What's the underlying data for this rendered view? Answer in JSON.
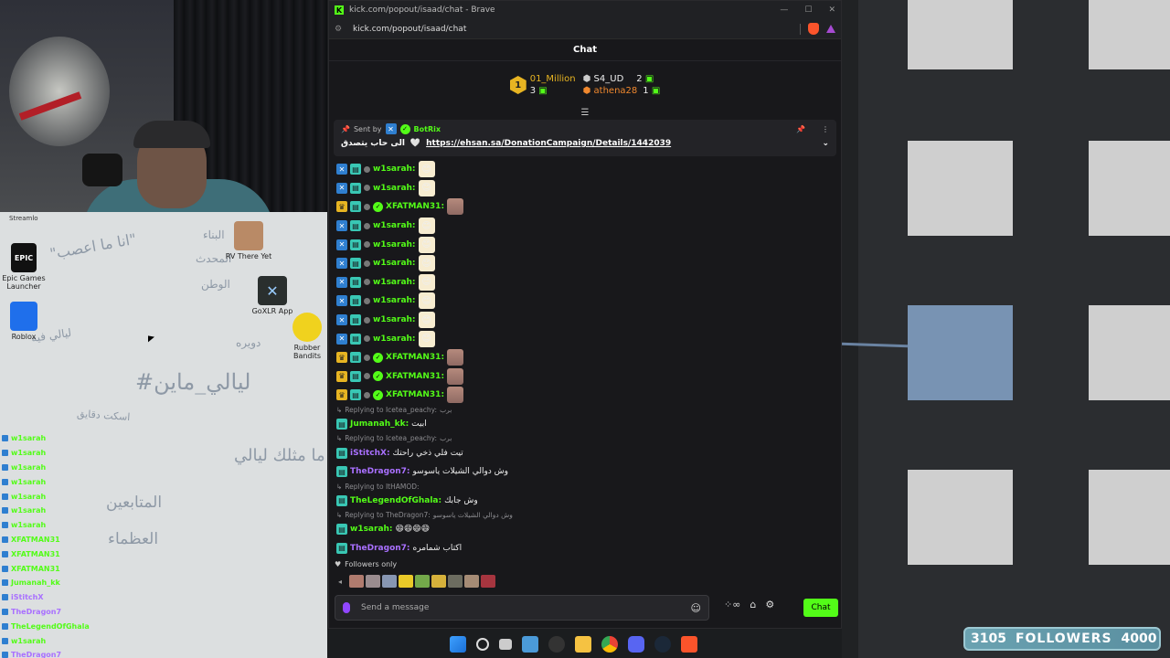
{
  "browser": {
    "title": "kick.com/popout/isaad/chat - Brave",
    "url": "kick.com/popout/isaad/chat"
  },
  "chat": {
    "header": "Chat",
    "leaderboard": {
      "first": {
        "rank": "1",
        "name": "01_Million",
        "count": "3"
      },
      "second": {
        "name": "S4_UD",
        "count": "2"
      },
      "third": {
        "name": "athena28",
        "count": "1"
      }
    },
    "pinned": {
      "sent_by": "Sent by",
      "sender": "BotRix",
      "text": "الى حاب يتصدق",
      "link": "https://ehsan.sa/DonationCampaign/Details/1442039"
    },
    "messages": [
      {
        "user": "w1sarah:",
        "color": "#53fc18",
        "kind": "msg",
        "sticker": "face"
      },
      {
        "user": "w1sarah:",
        "color": "#53fc18",
        "kind": "msg",
        "sticker": "face"
      },
      {
        "user": "XFATMAN31:",
        "color": "#53fc18",
        "kind": "msg",
        "sticker": "photo",
        "crown": true
      },
      {
        "user": "w1sarah:",
        "color": "#53fc18",
        "kind": "msg",
        "sticker": "face"
      },
      {
        "user": "w1sarah:",
        "color": "#53fc18",
        "kind": "msg",
        "sticker": "face"
      },
      {
        "user": "w1sarah:",
        "color": "#53fc18",
        "kind": "msg",
        "sticker": "face"
      },
      {
        "user": "w1sarah:",
        "color": "#53fc18",
        "kind": "msg",
        "sticker": "face"
      },
      {
        "user": "w1sarah:",
        "color": "#53fc18",
        "kind": "msg",
        "sticker": "face"
      },
      {
        "user": "w1sarah:",
        "color": "#53fc18",
        "kind": "msg",
        "sticker": "face"
      },
      {
        "user": "w1sarah:",
        "color": "#53fc18",
        "kind": "msg",
        "sticker": "face"
      },
      {
        "user": "XFATMAN31:",
        "color": "#53fc18",
        "kind": "msg",
        "sticker": "photo",
        "crown": true
      },
      {
        "user": "XFATMAN31:",
        "color": "#53fc18",
        "kind": "msg",
        "sticker": "photo",
        "crown": true
      },
      {
        "user": "XFATMAN31:",
        "color": "#53fc18",
        "kind": "msg",
        "sticker": "photo",
        "crown": true
      }
    ],
    "replies": [
      {
        "reply_to": "Replying to Icetea_peachy:",
        "reply_text": "برب",
        "user": "Jumanah_kk:",
        "color": "#53fc18",
        "text": "ابيت"
      },
      {
        "reply_to": "Replying to Icetea_peachy:",
        "reply_text": "برب",
        "user": "iStitchX:",
        "color": "#a970ff",
        "text": "تيت فلي ذخي راحتك"
      },
      {
        "reply_to": "",
        "reply_text": "",
        "user": "TheDragon7:",
        "color": "#a970ff",
        "text": "وش دوالي الشيلات ياسوسو"
      },
      {
        "reply_to": "Replying to ItHAMOD:",
        "reply_text": "",
        "user": "TheLegendOfGhala:",
        "color": "#53fc18",
        "text": "وش جابك"
      },
      {
        "reply_to": "Replying to TheDragon7:",
        "reply_text": "وش دوالي الشيلات ياسوسو",
        "user": "w1sarah:",
        "color": "#53fc18",
        "text": "😄😄😄😄"
      },
      {
        "reply_to": "",
        "reply_text": "",
        "user": "TheDragon7:",
        "color": "#a970ff",
        "text": "اكتاب شمامره"
      }
    ],
    "followers_only": "Followers only",
    "composer_placeholder": "Send a message",
    "send_label": "Chat",
    "infinity": "∞"
  },
  "desktop": {
    "icons": [
      {
        "label": "Epic Games Launcher"
      },
      {
        "label": "Roblox"
      },
      {
        "label": "RV There Yet"
      },
      {
        "label": "GoXLR App"
      },
      {
        "label": "Rubber Bandits"
      }
    ],
    "streamlabs_label": "Streamlo",
    "words": [
      "\"انا ما اعصب\"",
      "البناء",
      "المحدث",
      "الوطن",
      "ليالي فيه",
      "دويره",
      "#ليالي_ماين",
      "اسكت دقايق",
      "ما مثلك ليالي",
      "المتابعين",
      "العظماء"
    ]
  },
  "overlay_chat": [
    {
      "user": "w1sarah",
      "color": "#53fc18"
    },
    {
      "user": "w1sarah",
      "color": "#53fc18"
    },
    {
      "user": "w1sarah",
      "color": "#53fc18"
    },
    {
      "user": "w1sarah",
      "color": "#53fc18"
    },
    {
      "user": "w1sarah",
      "color": "#53fc18"
    },
    {
      "user": "w1sarah",
      "color": "#53fc18"
    },
    {
      "user": "w1sarah",
      "color": "#53fc18"
    },
    {
      "user": "XFATMAN31",
      "color": "#53fc18"
    },
    {
      "user": "XFATMAN31",
      "color": "#53fc18"
    },
    {
      "user": "XFATMAN31",
      "color": "#53fc18"
    },
    {
      "user": "Jumanah_kk",
      "color": "#53fc18"
    },
    {
      "user": "iStitchX",
      "color": "#a970ff"
    },
    {
      "user": "TheDragon7",
      "color": "#a970ff"
    },
    {
      "user": "TheLegendOfGhala",
      "color": "#53fc18"
    },
    {
      "user": "w1sarah",
      "color": "#53fc18"
    },
    {
      "user": "TheDragon7",
      "color": "#a970ff"
    }
  ],
  "stream": {
    "followers_count": "3105",
    "followers_label": "FOLLOWERS",
    "followers_goal": "4000"
  }
}
